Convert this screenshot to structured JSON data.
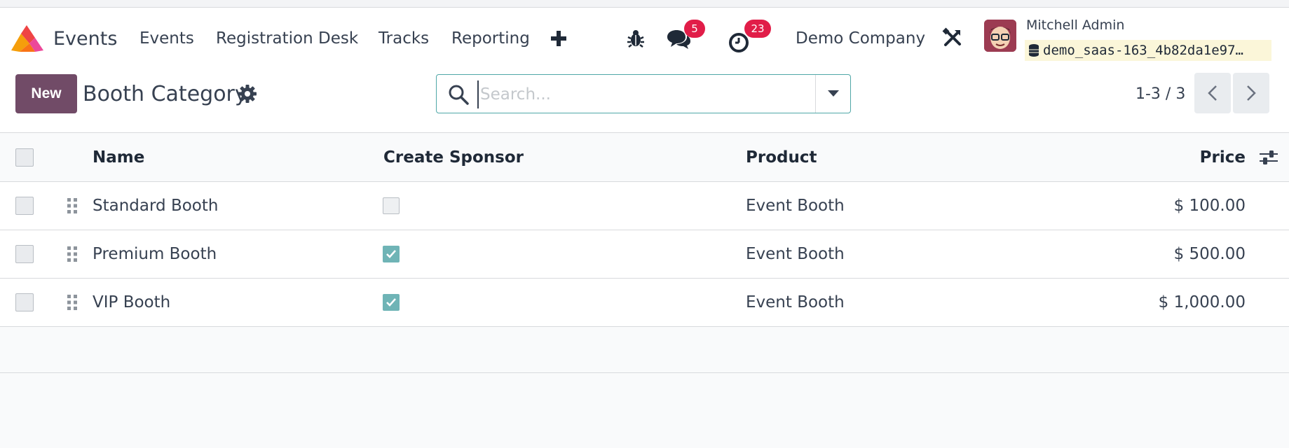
{
  "navbar": {
    "app_name": "Events",
    "menu": [
      "Events",
      "Registration Desk",
      "Tracks",
      "Reporting"
    ],
    "plus_label": "✚",
    "messages_count": "5",
    "activities_count": "23",
    "company": "Demo Company",
    "user_name": "Mitchell Admin",
    "database": "demo_saas-163_4b82da1e97…"
  },
  "control": {
    "new_label": "New",
    "title": "Booth Category",
    "search_placeholder": "Search...",
    "pager": "1-3 / 3"
  },
  "table": {
    "columns": [
      "Name",
      "Create Sponsor",
      "Product",
      "Price"
    ],
    "rows": [
      {
        "name": "Standard Booth",
        "create_sponsor": false,
        "product": "Event Booth",
        "price": "$ 100.00"
      },
      {
        "name": "Premium Booth",
        "create_sponsor": true,
        "product": "Event Booth",
        "price": "$ 500.00"
      },
      {
        "name": "VIP Booth",
        "create_sponsor": true,
        "product": "Event Booth",
        "price": "$ 1,000.00"
      }
    ]
  },
  "colors": {
    "brand": "#714b67",
    "badge": "#e11d48",
    "checkbox_checked": "#6fb4b6",
    "search_border": "#4fa7a7"
  }
}
